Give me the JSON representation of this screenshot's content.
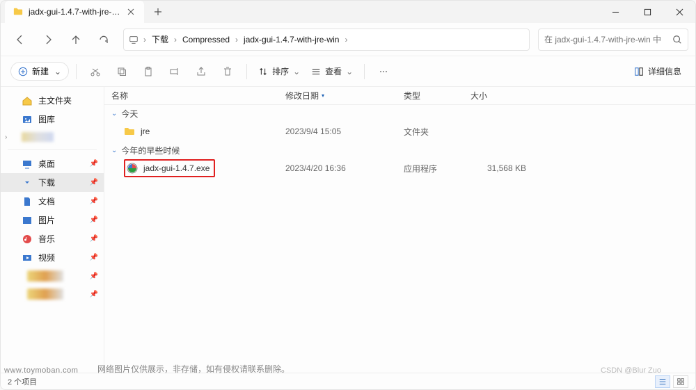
{
  "window": {
    "tab_title": "jadx-gui-1.4.7-with-jre-win"
  },
  "breadcrumb": {
    "items": [
      "下载",
      "Compressed",
      "jadx-gui-1.4.7-with-jre-win"
    ]
  },
  "search": {
    "placeholder": "在 jadx-gui-1.4.7-with-jre-win 中"
  },
  "cmdbar": {
    "new_label": "新建",
    "sort_label": "排序",
    "view_label": "查看",
    "details_label": "详细信息"
  },
  "sidebar": {
    "home": "主文件夹",
    "gallery": "图库",
    "desktop": "桌面",
    "downloads": "下载",
    "documents": "文档",
    "pictures": "图片",
    "music": "音乐",
    "videos": "视频"
  },
  "columns": {
    "name": "名称",
    "date": "修改日期",
    "type": "类型",
    "size": "大小"
  },
  "groups": {
    "today": "今天",
    "earlier": "今年的早些时候"
  },
  "files": [
    {
      "name": "jre",
      "date": "2023/9/4 15:05",
      "type": "文件夹",
      "size": ""
    },
    {
      "name": "jadx-gui-1.4.7.exe",
      "date": "2023/4/20 16:36",
      "type": "应用程序",
      "size": "31,568 KB"
    }
  ],
  "status": {
    "count": "2 个项目"
  },
  "watermark": "www.toymoban.com",
  "caption": "网络图片仅供展示，非存储，如有侵权请联系删除。",
  "csdn": "CSDN @Blur Zuo"
}
